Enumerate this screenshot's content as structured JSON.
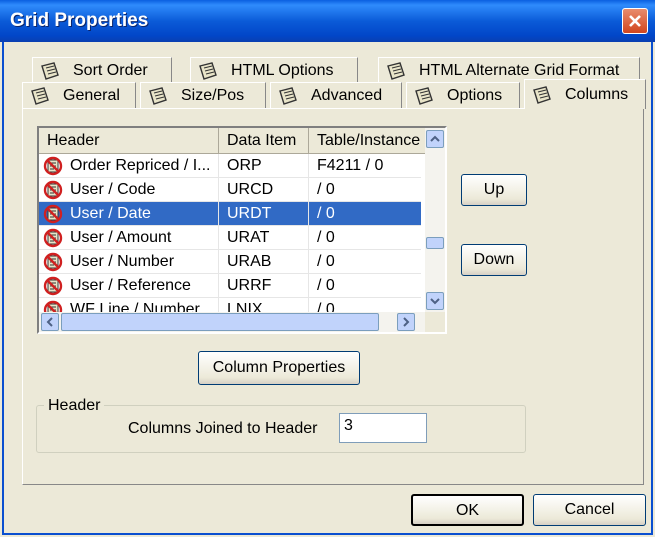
{
  "window": {
    "title": "Grid Properties",
    "close_icon": "close-icon"
  },
  "tabs_row1": [
    {
      "label": "Sort Order",
      "icon": "tab-page-icon"
    },
    {
      "label": "HTML Options",
      "icon": "tab-page-icon"
    },
    {
      "label": "HTML Alternate Grid Format",
      "icon": "tab-page-icon"
    }
  ],
  "tabs_row2": [
    {
      "label": "General",
      "icon": "tab-page-icon"
    },
    {
      "label": "Size/Pos",
      "icon": "tab-page-icon"
    },
    {
      "label": "Advanced",
      "icon": "tab-page-icon"
    },
    {
      "label": "Options",
      "icon": "tab-page-icon"
    },
    {
      "label": "Columns",
      "icon": "tab-page-icon",
      "active": true
    }
  ],
  "grid": {
    "headers": [
      "Header",
      "Data Item",
      "Table/Instance"
    ],
    "rows": [
      {
        "header": "Order Repriced / I...",
        "data_item": "ORP",
        "table": "F4211 / 0",
        "selected": false
      },
      {
        "header": "User / Code",
        "data_item": "URCD",
        "table": " / 0",
        "selected": false
      },
      {
        "header": "User / Date",
        "data_item": "URDT",
        "table": " / 0",
        "selected": true
      },
      {
        "header": "User / Amount",
        "data_item": "URAT",
        "table": " / 0",
        "selected": false
      },
      {
        "header": "User / Number",
        "data_item": "URAB",
        "table": " / 0",
        "selected": false
      },
      {
        "header": "User / Reference",
        "data_item": "URRF",
        "table": " / 0",
        "selected": false
      },
      {
        "header": "WF Line / Number",
        "data_item": "LNIX",
        "table": " / 0",
        "selected": false
      }
    ]
  },
  "buttons": {
    "up": "Up",
    "down": "Down",
    "column_properties": "Column Properties",
    "ok": "OK",
    "cancel": "Cancel"
  },
  "header_group": {
    "legend": "Header",
    "field_label": "Columns Joined to Header",
    "field_value": "3"
  },
  "colors": {
    "title_bar": "#0a5fe0",
    "selection": "#316ac5",
    "face": "#ece9d8"
  }
}
